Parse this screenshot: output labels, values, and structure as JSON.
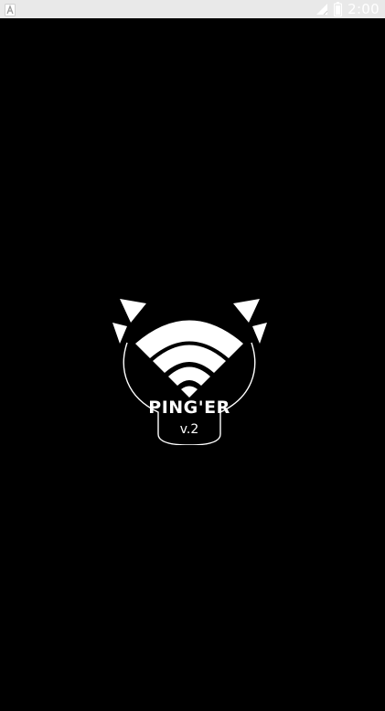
{
  "status_bar": {
    "time": "2:00",
    "icons": [
      "notification-a-icon",
      "signal-icon",
      "battery-icon"
    ]
  },
  "splash": {
    "app_name": "PING'ER",
    "version": "v.2",
    "logo_icon": "wifi-devil-logo-icon"
  },
  "colors": {
    "background": "#000000",
    "status_bar": "#e9e9e9",
    "foreground": "#ffffff"
  }
}
